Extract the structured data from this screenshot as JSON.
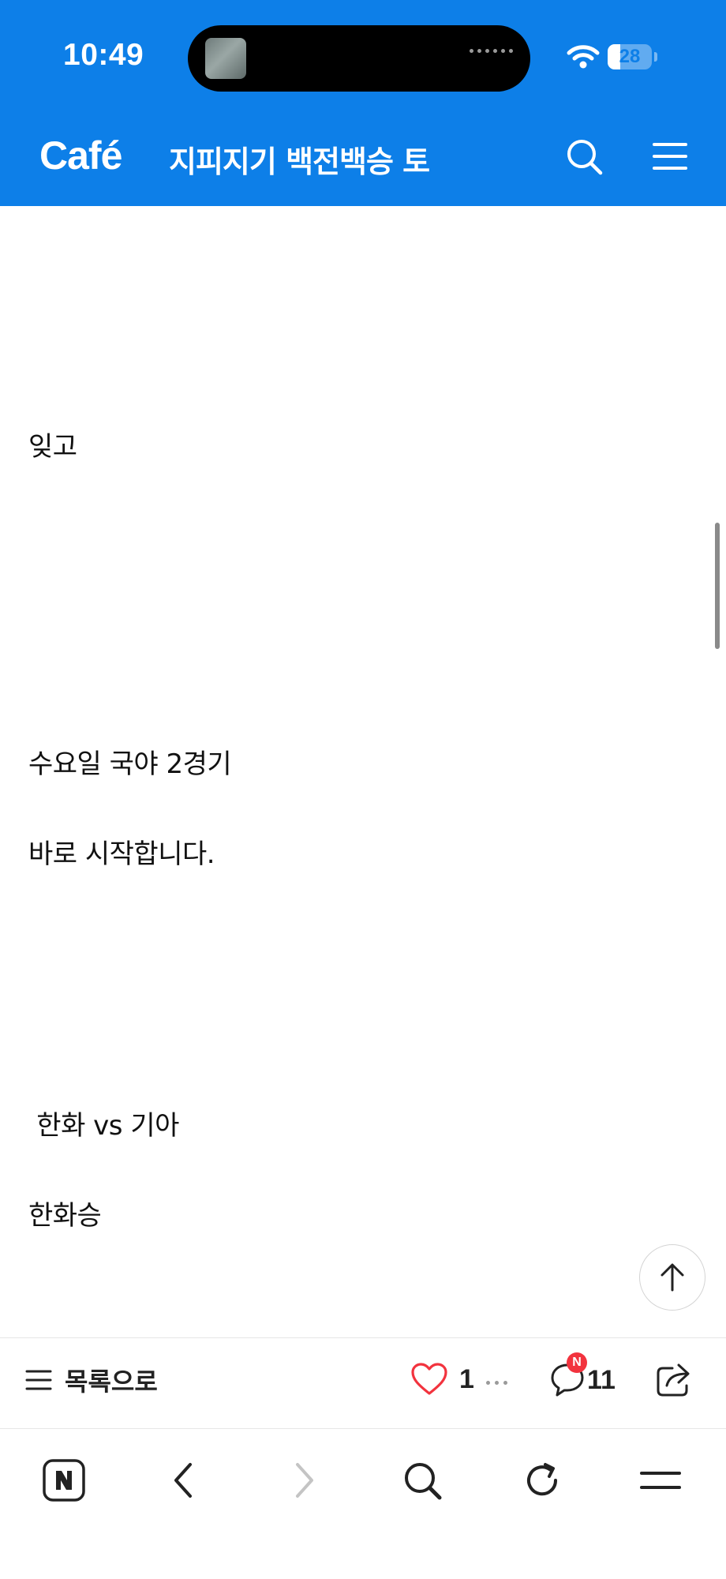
{
  "status_bar": {
    "time": "10:49",
    "battery": "28",
    "battery_level_percent": 28,
    "icons": [
      "wifi-icon",
      "battery-icon"
    ]
  },
  "header": {
    "logo": "Café",
    "cafe_name": "지피지기 백전백승 토",
    "icons": [
      "search-icon",
      "menu-icon"
    ],
    "background_color": "#0d7fe8"
  },
  "article": {
    "lines": [
      "잊고",
      "수요일 국야 2경기",
      "바로 시작합니다.",
      " 한화 vs 기아",
      "한화승"
    ]
  },
  "scroll_top_icon": "arrow-up-icon",
  "action_bar": {
    "list_label": "목록으로",
    "like_count": "1",
    "comment_count": "11",
    "new_badge": "N",
    "accent_color": "#f2333e",
    "icons": [
      "list-icon",
      "heart-icon",
      "more-icon",
      "comment-icon",
      "share-icon"
    ]
  },
  "browser_toolbar": {
    "icons": [
      "naver-home-icon",
      "back-icon",
      "forward-icon",
      "search-icon",
      "reload-icon",
      "menu-icon"
    ]
  }
}
